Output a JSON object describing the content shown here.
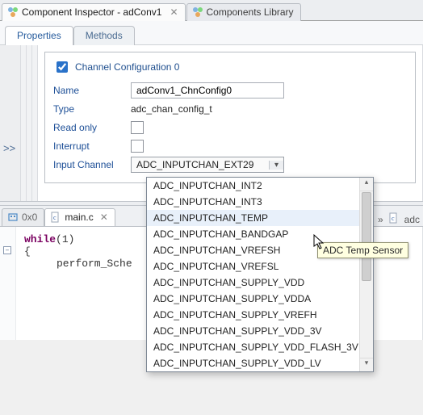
{
  "topTabs": {
    "active": {
      "label": "Component Inspector - adConv1"
    },
    "inactive": {
      "label": "Components Library"
    }
  },
  "subTabs": {
    "properties": "Properties",
    "methods": "Methods"
  },
  "gutter": {
    "collapseLabel": ">>"
  },
  "group": {
    "title": "Channel Configuration 0",
    "checked": true,
    "rows": {
      "nameLabel": "Name",
      "nameValue": "adConv1_ChnConfig0",
      "typeLabel": "Type",
      "typeValue": "adc_chan_config_t",
      "readonlyLabel": "Read only",
      "interruptLabel": "Interrupt",
      "inputChLabel": "Input Channel",
      "inputChValue": "ADC_INPUTCHAN_EXT29"
    }
  },
  "dropdown": {
    "options": [
      "ADC_INPUTCHAN_INT2",
      "ADC_INPUTCHAN_INT3",
      "ADC_INPUTCHAN_TEMP",
      "ADC_INPUTCHAN_BANDGAP",
      "ADC_INPUTCHAN_VREFSH",
      "ADC_INPUTCHAN_VREFSL",
      "ADC_INPUTCHAN_SUPPLY_VDD",
      "ADC_INPUTCHAN_SUPPLY_VDDA",
      "ADC_INPUTCHAN_SUPPLY_VREFH",
      "ADC_INPUTCHAN_SUPPLY_VDD_3V",
      "ADC_INPUTCHAN_SUPPLY_VDD_FLASH_3V",
      "ADC_INPUTCHAN_SUPPLY_VDD_LV"
    ],
    "highlight": "ADC_INPUTCHAN_TEMP"
  },
  "tooltip": "ADC Temp Sensor",
  "editorTabs": {
    "hex": "0x0",
    "file": "main.c",
    "trail": "adc"
  },
  "code": {
    "l1a": "while",
    "l1b": "(1)",
    "l2": "{",
    "l3": "perform_Sche"
  }
}
